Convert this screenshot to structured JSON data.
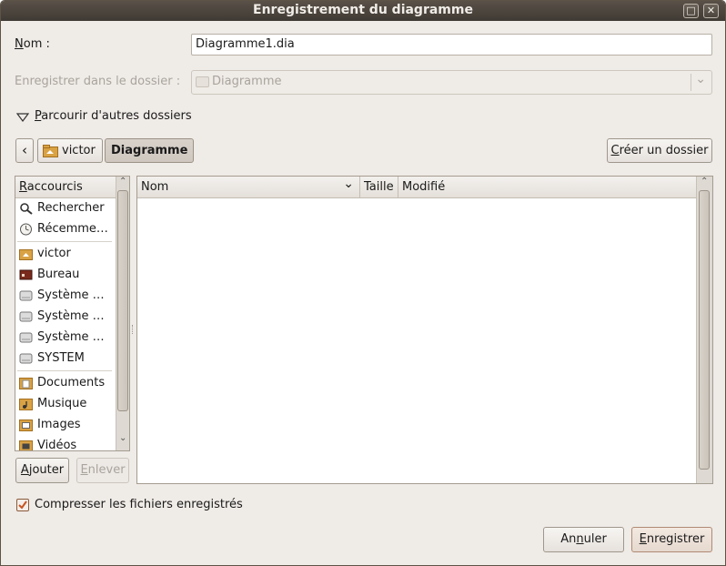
{
  "window": {
    "title": "Enregistrement du diagramme",
    "maximize_glyph": "□",
    "close_glyph": "✕"
  },
  "name_row": {
    "label": "Nom :",
    "label_mnemonic": "N",
    "label_rest": "om :",
    "value": "Diagramme1.dia"
  },
  "folder_row": {
    "label": "Enregistrer dans le dossier :",
    "value": "Diagramme",
    "arrow_glyph": "⌄"
  },
  "browse": {
    "label_mnemonic": "P",
    "label_rest": "arcourir d'autres dossiers"
  },
  "pathbar": {
    "back_glyph": "‹",
    "crumbs": [
      "victor",
      "Diagramme"
    ],
    "create_folder_mnemonic": "C",
    "create_folder_rest": "réer un dossier"
  },
  "sidebar": {
    "header_mnemonic": "R",
    "header_rest": "accourcis",
    "items": [
      {
        "label": "Rechercher",
        "icon": "search-icon"
      },
      {
        "label": "Récemme…",
        "icon": "recent-icon"
      },
      {
        "label": "victor",
        "icon": "home-folder-icon"
      },
      {
        "label": "Bureau",
        "icon": "desktop-icon"
      },
      {
        "label": "Système …",
        "icon": "drive-icon"
      },
      {
        "label": "Système …",
        "icon": "drive-icon"
      },
      {
        "label": "Système …",
        "icon": "drive-icon"
      },
      {
        "label": "SYSTEM",
        "icon": "drive-icon"
      },
      {
        "label": "Documents",
        "icon": "documents-folder-icon"
      },
      {
        "label": "Musique",
        "icon": "music-folder-icon"
      },
      {
        "label": "Images",
        "icon": "pictures-folder-icon"
      },
      {
        "label": "Vidéos",
        "icon": "videos-folder-icon"
      }
    ],
    "add_mnemonic": "A",
    "add_rest": "jouter",
    "remove_mnemonic": "E",
    "remove_rest": "nlever"
  },
  "filelist": {
    "columns": [
      "Nom",
      "Taille",
      "Modifié"
    ],
    "sort_glyph": "⌄",
    "rows": []
  },
  "compress": {
    "label": "Compresser les fichiers enregistrés",
    "checked": true
  },
  "buttons": {
    "cancel_pre": "An",
    "cancel_mnemonic": "n",
    "cancel_post": "uler",
    "save_mnemonic": "E",
    "save_rest": "nregistrer"
  },
  "colors": {
    "window_bg": "#efebe7",
    "titlebar": "#4a433c",
    "accent_check": "#c9531f"
  }
}
